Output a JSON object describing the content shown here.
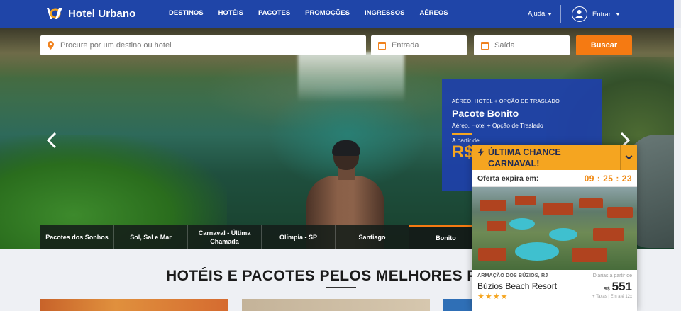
{
  "header": {
    "brand": "Hotel Urbano",
    "nav": [
      "DESTINOS",
      "HOTÉIS",
      "PACOTES",
      "PROMOÇÕES",
      "INGRESSOS",
      "AÉREOS"
    ],
    "help_label": "Ajuda",
    "login_label": "Entrar"
  },
  "search": {
    "destination_placeholder": "Procure por um destino ou hotel",
    "checkin_placeholder": "Entrada",
    "checkout_placeholder": "Saída",
    "button_label": "Buscar"
  },
  "promo": {
    "kicker": "AÉREO, HOTEL + OPÇÃO DE TRASLADO",
    "title": "Pacote Bonito",
    "subtitle": "Aéreo, Hotel + Opção de Traslado",
    "from_label": "A partir de",
    "price_partial": "R$"
  },
  "categories": [
    {
      "label": "Pacotes dos Sonhos",
      "active": false
    },
    {
      "label": "Sol, Sal e Mar",
      "active": false
    },
    {
      "label": "Carnaval - Última Chamada",
      "active": false
    },
    {
      "label": "Olímpia - SP",
      "active": false
    },
    {
      "label": "Santiago",
      "active": false
    },
    {
      "label": "Bonito",
      "active": true
    }
  ],
  "section": {
    "title": "HOTÉIS E PACOTES PELOS MELHORES PRE"
  },
  "popup": {
    "headline": "ÚLTIMA CHANCE CARNAVAL!",
    "timer_label": "Oferta expira em:",
    "timer": "09 : 25 : 23",
    "location": "ARMAÇÃO DOS BÚZIOS, RJ",
    "daily_label": "Diárias a partir de",
    "hotel_name": "Búzios Beach Resort",
    "stars": "★★★★",
    "star_rating": 4,
    "currency": "R$",
    "price": "551",
    "taxes_note": "+ Taxas | Em até 12x"
  },
  "colors": {
    "header_bg": "#1f45a8",
    "accent_orange": "#f57a12",
    "popup_yellow": "#f5a520"
  }
}
